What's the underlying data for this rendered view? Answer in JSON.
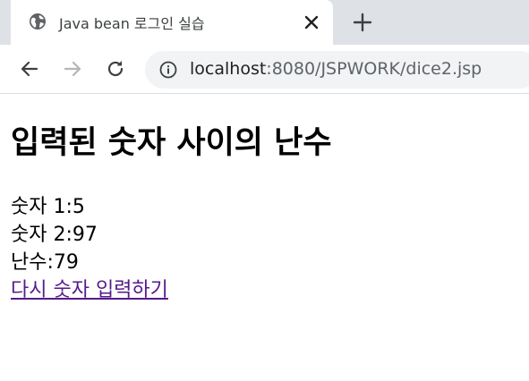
{
  "browser": {
    "tab_title": "Java bean 로그인 실습",
    "url_host": "localhost",
    "url_path": ":8080/JSPWORK/dice2.jsp"
  },
  "page": {
    "heading": "입력된 숫자 사이의 난수",
    "num1_label": "숫자 1:",
    "num1_value": "5",
    "num2_label": "숫자 2:",
    "num2_value": "97",
    "random_label": "난수:",
    "random_value": "79",
    "retry_link": "다시 숫자 입력하기"
  }
}
